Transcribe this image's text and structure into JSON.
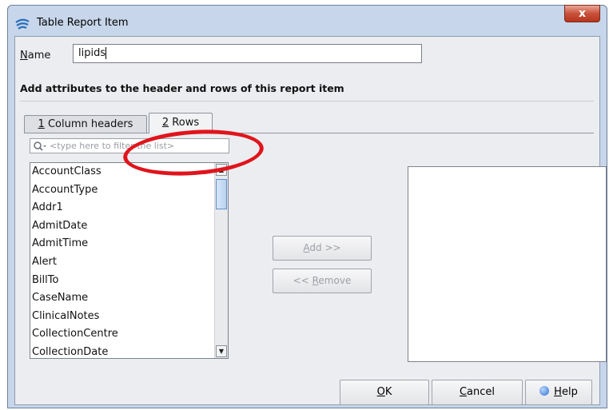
{
  "window": {
    "title": "Table Report Item",
    "close_label": "x"
  },
  "name_field": {
    "label_mnemonic": "N",
    "label_rest": "ame",
    "value": "lipids"
  },
  "instruction": "Add attributes to the header and rows of this report item",
  "tabs": [
    {
      "mnemonic": "1",
      "label": " Column headers"
    },
    {
      "mnemonic": "2",
      "label": " Rows",
      "selected": true
    }
  ],
  "filter": {
    "placeholder": "<type here to filter the list>"
  },
  "attributes": [
    "AccountClass",
    "AccountType",
    "Addr1",
    "AdmitDate",
    "AdmitTime",
    "Alert",
    "BillTo",
    "CaseName",
    "ClinicalNotes",
    "CollectionCentre",
    "CollectionDate"
  ],
  "buttons": {
    "add": {
      "mnemonic": "A",
      "rest": "dd >>"
    },
    "remove": {
      "prefix": "<< ",
      "mnemonic": "R",
      "rest": "emove"
    },
    "ok": {
      "mnemonic": "O",
      "rest": "K"
    },
    "cancel": {
      "mnemonic": "C",
      "rest": "ancel"
    },
    "help": {
      "mnemonic": "H",
      "rest": "elp"
    }
  },
  "icons": {
    "app": "wifi-swoosh-icon",
    "search": "search-icon",
    "help": "help-icon",
    "scroll_up": "arrow-up-icon",
    "scroll_down": "arrow-down-icon"
  },
  "colors": {
    "highlight_ring": "#e0141c",
    "title_bar": "#c7d6ea",
    "close_button": "#c8513b"
  }
}
